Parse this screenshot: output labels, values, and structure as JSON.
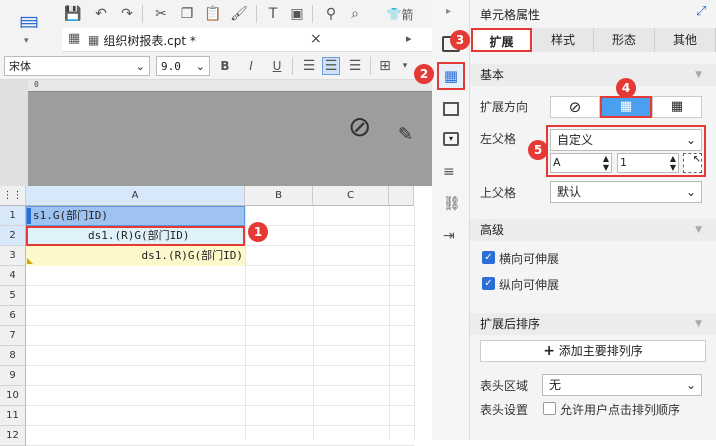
{
  "toolbar": {
    "font_name": "宋体",
    "font_size": "9.0",
    "bold": "B",
    "italic": "I",
    "underline": "U",
    "menu_tail": "箭"
  },
  "tab": {
    "title": "组织树报表.cpt *",
    "close": "×"
  },
  "grid": {
    "col_headers": [
      "A",
      "B",
      "C"
    ],
    "row_numbers": [
      "1",
      "2",
      "3",
      "4",
      "5",
      "6",
      "7",
      "8",
      "9",
      "10",
      "11",
      "12"
    ],
    "cells": {
      "a1": "s1.G(部门ID)",
      "a2": "ds1.(R)G(部门ID)",
      "a3": "ds1.(R)G(部门ID)"
    }
  },
  "badges": [
    "1",
    "2",
    "3",
    "4",
    "5"
  ],
  "panel": {
    "title": "单元格属性",
    "tabs": [
      "扩展",
      "样式",
      "形态",
      "其他"
    ],
    "section_basic": "基本",
    "expand_dir_label": "扩展方向",
    "left_parent_label": "左父格",
    "left_parent_value": "自定义",
    "left_parent_col": "A",
    "left_parent_row": "1",
    "top_parent_label": "上父格",
    "top_parent_value": "默认",
    "section_advanced": "高级",
    "horiz_expand": "横向可伸展",
    "vert_expand": "纵向可伸展",
    "section_sort": "扩展后排序",
    "add_sort_button": "添加主要排列序",
    "header_area_label": "表头区域",
    "header_area_value": "无",
    "header_setting_label": "表头设置",
    "header_setting_option": "允许用户点击排列顺序"
  },
  "colors": {
    "accent": "#2b6fd6",
    "badge": "#e53935",
    "selected_cell": "#9ec3f0",
    "row3": "#fdf7cc"
  }
}
